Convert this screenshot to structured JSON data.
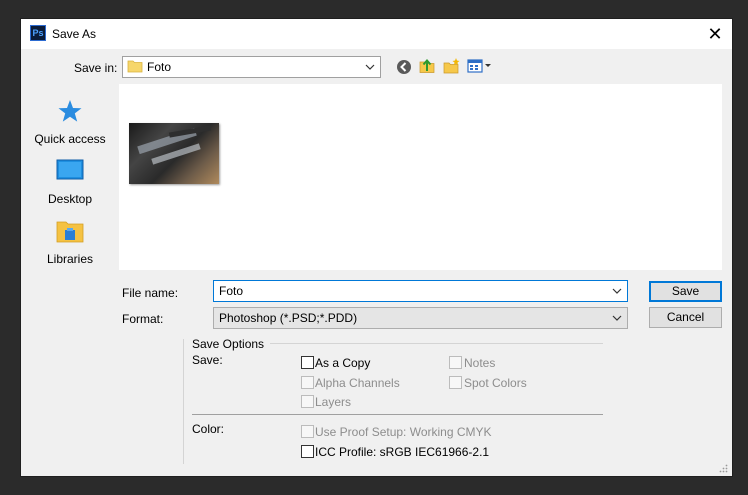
{
  "window": {
    "title": "Save As",
    "app_icon": "Ps"
  },
  "save_in": {
    "label": "Save in:",
    "value": "Foto"
  },
  "places": [
    {
      "label": "Quick access",
      "icon": "star-icon"
    },
    {
      "label": "Desktop",
      "icon": "desktop-icon"
    },
    {
      "label": "Libraries",
      "icon": "libraries-icon"
    }
  ],
  "form": {
    "file_name_label": "File name:",
    "file_name_value": "Foto",
    "format_label": "Format:",
    "format_value": "Photoshop (*.PSD;*.PDD)"
  },
  "buttons": {
    "save": "Save",
    "cancel": "Cancel"
  },
  "save_options": {
    "heading": "Save Options",
    "save_label": "Save:",
    "as_a_copy": "As a Copy",
    "notes": "Notes",
    "alpha_channels": "Alpha Channels",
    "spot_colors": "Spot Colors",
    "layers": "Layers",
    "color_label": "Color:",
    "use_proof_setup": "Use Proof Setup:  Working CMYK",
    "icc_profile": "ICC Profile:  sRGB IEC61966-2.1"
  },
  "colors": {
    "accent": "#0078d7",
    "ps_blue": "#4fa3ff"
  }
}
